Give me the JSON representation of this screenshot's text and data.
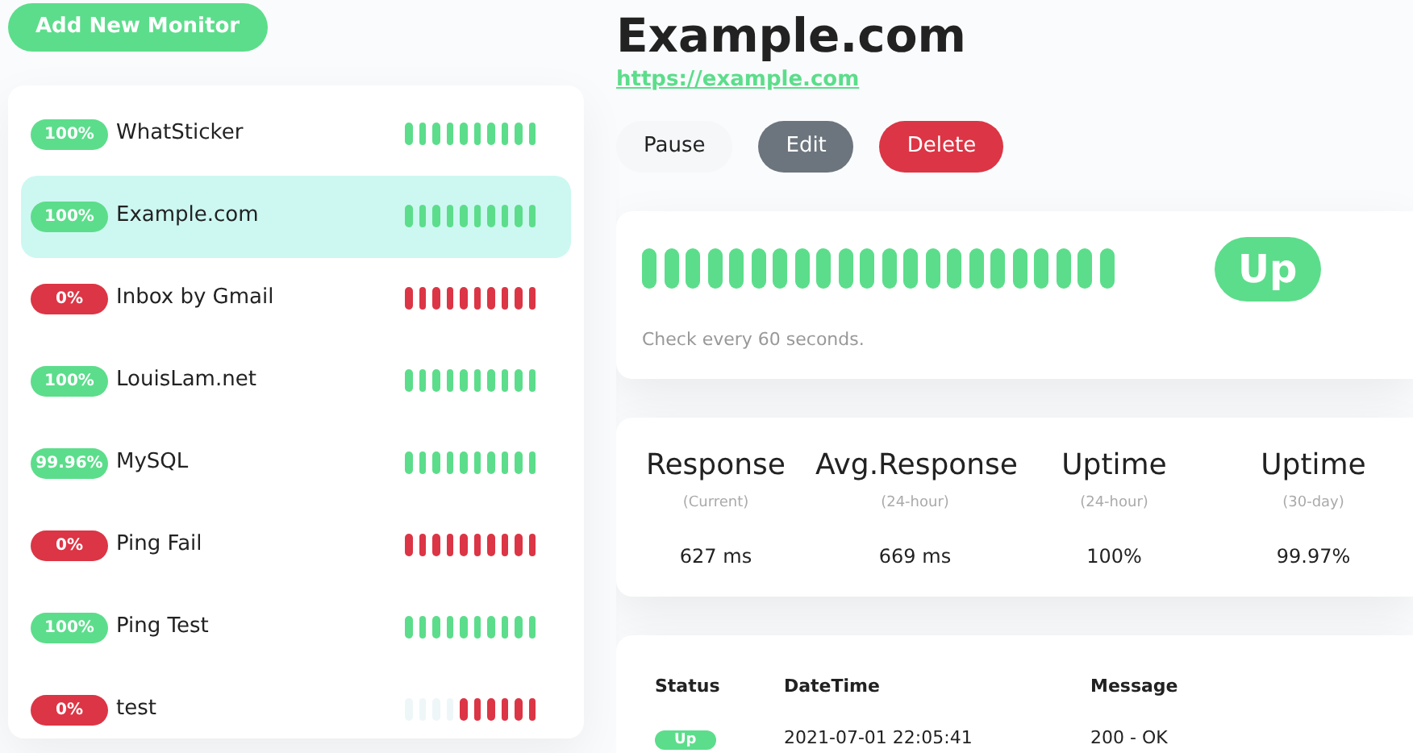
{
  "add_button": "Add New Monitor",
  "monitors": [
    {
      "uptime": "100%",
      "color": "#5cdd8b",
      "name": "WhatSticker",
      "selected": false,
      "beats": [
        {
          "color": "#5cdd8b"
        },
        {
          "color": "#5cdd8b"
        },
        {
          "color": "#5cdd8b"
        },
        {
          "color": "#5cdd8b"
        },
        {
          "color": "#5cdd8b"
        },
        {
          "color": "#5cdd8b"
        },
        {
          "color": "#5cdd8b"
        },
        {
          "color": "#5cdd8b"
        },
        {
          "color": "#5cdd8b"
        },
        {
          "color": "#5cdd8b"
        }
      ]
    },
    {
      "uptime": "100%",
      "color": "#5cdd8b",
      "name": "Example.com",
      "selected": true,
      "beats": [
        {
          "color": "#5cdd8b"
        },
        {
          "color": "#5cdd8b"
        },
        {
          "color": "#5cdd8b"
        },
        {
          "color": "#5cdd8b"
        },
        {
          "color": "#5cdd8b"
        },
        {
          "color": "#5cdd8b"
        },
        {
          "color": "#5cdd8b"
        },
        {
          "color": "#5cdd8b"
        },
        {
          "color": "#5cdd8b"
        },
        {
          "color": "#5cdd8b"
        }
      ]
    },
    {
      "uptime": "0%",
      "color": "#dc3545",
      "name": "Inbox by Gmail",
      "selected": false,
      "beats": [
        {
          "color": "#dc3545"
        },
        {
          "color": "#dc3545"
        },
        {
          "color": "#dc3545"
        },
        {
          "color": "#dc3545"
        },
        {
          "color": "#dc3545"
        },
        {
          "color": "#dc3545"
        },
        {
          "color": "#dc3545"
        },
        {
          "color": "#dc3545"
        },
        {
          "color": "#dc3545"
        },
        {
          "color": "#dc3545"
        }
      ]
    },
    {
      "uptime": "100%",
      "color": "#5cdd8b",
      "name": "LouisLam.net",
      "selected": false,
      "beats": [
        {
          "color": "#5cdd8b"
        },
        {
          "color": "#5cdd8b"
        },
        {
          "color": "#5cdd8b"
        },
        {
          "color": "#5cdd8b"
        },
        {
          "color": "#5cdd8b"
        },
        {
          "color": "#5cdd8b"
        },
        {
          "color": "#5cdd8b"
        },
        {
          "color": "#5cdd8b"
        },
        {
          "color": "#5cdd8b"
        },
        {
          "color": "#5cdd8b"
        }
      ]
    },
    {
      "uptime": "99.96%",
      "color": "#5cdd8b",
      "name": "MySQL",
      "selected": false,
      "beats": [
        {
          "color": "#5cdd8b"
        },
        {
          "color": "#5cdd8b"
        },
        {
          "color": "#5cdd8b"
        },
        {
          "color": "#5cdd8b"
        },
        {
          "color": "#5cdd8b"
        },
        {
          "color": "#5cdd8b"
        },
        {
          "color": "#5cdd8b"
        },
        {
          "color": "#5cdd8b"
        },
        {
          "color": "#5cdd8b"
        },
        {
          "color": "#5cdd8b"
        }
      ]
    },
    {
      "uptime": "0%",
      "color": "#dc3545",
      "name": "Ping Fail",
      "selected": false,
      "beats": [
        {
          "color": "#dc3545"
        },
        {
          "color": "#dc3545"
        },
        {
          "color": "#dc3545"
        },
        {
          "color": "#dc3545"
        },
        {
          "color": "#dc3545"
        },
        {
          "color": "#dc3545"
        },
        {
          "color": "#dc3545"
        },
        {
          "color": "#dc3545"
        },
        {
          "color": "#dc3545"
        },
        {
          "color": "#dc3545"
        }
      ]
    },
    {
      "uptime": "100%",
      "color": "#5cdd8b",
      "name": "Ping Test",
      "selected": false,
      "beats": [
        {
          "color": "#5cdd8b"
        },
        {
          "color": "#5cdd8b"
        },
        {
          "color": "#5cdd8b"
        },
        {
          "color": "#5cdd8b"
        },
        {
          "color": "#5cdd8b"
        },
        {
          "color": "#5cdd8b"
        },
        {
          "color": "#5cdd8b"
        },
        {
          "color": "#5cdd8b"
        },
        {
          "color": "#5cdd8b"
        },
        {
          "color": "#5cdd8b"
        }
      ]
    },
    {
      "uptime": "0%",
      "color": "#dc3545",
      "name": "test",
      "selected": false,
      "beats": [
        {
          "color": "#eef6f8"
        },
        {
          "color": "#eef6f8"
        },
        {
          "color": "#eef6f8"
        },
        {
          "color": "#eef6f8"
        },
        {
          "color": "#dc3545"
        },
        {
          "color": "#dc3545"
        },
        {
          "color": "#dc3545"
        },
        {
          "color": "#dc3545"
        },
        {
          "color": "#dc3545"
        },
        {
          "color": "#dc3545"
        }
      ]
    }
  ],
  "detail": {
    "title": "Example.com",
    "url": "https://example.com",
    "buttons": [
      {
        "label": "Pause",
        "kind": "light"
      },
      {
        "label": "Edit",
        "kind": "secondary"
      },
      {
        "label": "Delete",
        "kind": "danger"
      }
    ],
    "heartbeat": {
      "beats": [
        {
          "color": "#5cdd8b"
        },
        {
          "color": "#5cdd8b"
        },
        {
          "color": "#5cdd8b"
        },
        {
          "color": "#5cdd8b"
        },
        {
          "color": "#5cdd8b"
        },
        {
          "color": "#5cdd8b"
        },
        {
          "color": "#5cdd8b"
        },
        {
          "color": "#5cdd8b"
        },
        {
          "color": "#5cdd8b"
        },
        {
          "color": "#5cdd8b"
        },
        {
          "color": "#5cdd8b"
        },
        {
          "color": "#5cdd8b"
        },
        {
          "color": "#5cdd8b"
        },
        {
          "color": "#5cdd8b"
        },
        {
          "color": "#5cdd8b"
        },
        {
          "color": "#5cdd8b"
        },
        {
          "color": "#5cdd8b"
        },
        {
          "color": "#5cdd8b"
        },
        {
          "color": "#5cdd8b"
        },
        {
          "color": "#5cdd8b"
        },
        {
          "color": "#5cdd8b"
        },
        {
          "color": "#5cdd8b"
        }
      ],
      "status_label": "Up",
      "color": "#5cdd8b",
      "interval_note": "Check every 60 seconds."
    },
    "stats": [
      {
        "title": "Response",
        "period": "(Current)",
        "value": "627 ms"
      },
      {
        "title": "Avg.Response",
        "period": "(24-hour)",
        "value": "669 ms"
      },
      {
        "title": "Uptime",
        "period": "(24-hour)",
        "value": "100%"
      },
      {
        "title": "Uptime",
        "period": "(30-day)",
        "value": "99.97%"
      }
    ],
    "events": {
      "columns": [
        "Status",
        "DateTime",
        "Message"
      ],
      "rows": [
        {
          "color": "#5cdd8b",
          "status_label": "Up",
          "datetime": "2021-07-01 22:05:41",
          "message": "200 - OK"
        }
      ]
    }
  }
}
